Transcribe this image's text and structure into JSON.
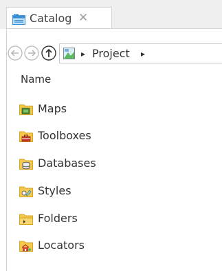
{
  "tab": {
    "title": "Catalog",
    "close_glyph": "✕",
    "icon": "catalog-icon"
  },
  "address": {
    "separator": "▸",
    "location": "Project",
    "back_icon": "back-arrow-icon",
    "forward_icon": "forward-arrow-icon",
    "up_icon": "up-arrow-icon",
    "location_icon": "project-icon"
  },
  "list": {
    "column_header": "Name",
    "items": [
      {
        "label": "Maps",
        "icon": "maps-folder-icon"
      },
      {
        "label": "Toolboxes",
        "icon": "toolboxes-folder-icon"
      },
      {
        "label": "Databases",
        "icon": "databases-folder-icon"
      },
      {
        "label": "Styles",
        "icon": "styles-folder-icon"
      },
      {
        "label": "Folders",
        "icon": "folders-folder-icon"
      },
      {
        "label": "Locators",
        "icon": "locators-folder-icon"
      }
    ]
  },
  "colors": {
    "folder": "#f2c94c",
    "folder_dark": "#d9a520",
    "catalog_blue": "#3b8fd6",
    "text": "#333333",
    "border": "#d4d4d4"
  }
}
